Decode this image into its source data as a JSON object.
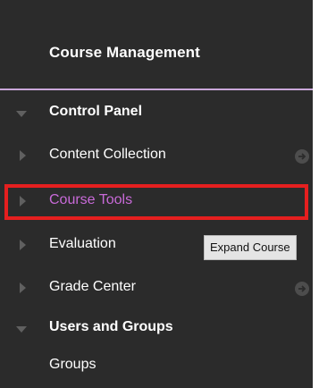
{
  "panel": {
    "heading": "Course Management",
    "items": [
      {
        "label": "Control Panel",
        "expanded": true,
        "bold": true
      },
      {
        "label": "Content Collection",
        "expanded": false,
        "bold": false,
        "has_arrow_icon": true
      },
      {
        "label": "Course Tools",
        "expanded": false,
        "bold": false,
        "highlighted": true
      },
      {
        "label": "Evaluation",
        "expanded": false,
        "bold": false
      },
      {
        "label": "Grade Center",
        "expanded": false,
        "bold": false,
        "has_arrow_icon": true
      },
      {
        "label": "Users and Groups",
        "expanded": true,
        "bold": true
      },
      {
        "label": "Groups",
        "expanded": false,
        "bold": false,
        "child": true
      }
    ]
  },
  "tooltip": {
    "text": "Expand Course"
  },
  "colors": {
    "panel_bg": "#2b2b2b",
    "divider": "#c9a7d9",
    "active_link": "#c86ad8",
    "highlight_border": "#e51f1f"
  }
}
